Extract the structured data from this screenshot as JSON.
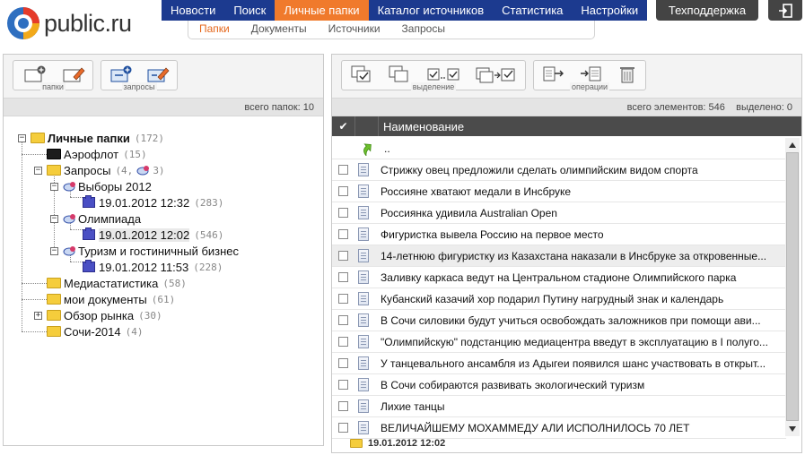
{
  "header": {
    "logo_text": "public.ru",
    "nav": [
      "Новости",
      "Поиск",
      "Личные папки",
      "Каталог источников",
      "Статистика",
      "Настройки"
    ],
    "nav_active": 2,
    "subnav": [
      "Папки",
      "Документы",
      "Источники",
      "Запросы"
    ],
    "subnav_active": 0,
    "support_label": "Техподдержка",
    "accent_color": "#f07a2c",
    "nav_color": "#1c3a8f"
  },
  "left_panel": {
    "toolbar_groups": [
      "папки",
      "запросы"
    ],
    "info": "всего папок: 10",
    "tree": [
      {
        "label": "Личные папки",
        "count": "(172)"
      },
      {
        "label": "Аэрофлот",
        "count": "(15)"
      },
      {
        "label": "Запросы",
        "count": "(4,",
        "count2": "3)"
      },
      {
        "label": "Выборы 2012",
        "count": ""
      },
      {
        "label": "19.01.2012 12:32",
        "count": "(283)"
      },
      {
        "label": "Олимпиада",
        "count": ""
      },
      {
        "label": "19.01.2012 12:02",
        "count": "(546)"
      },
      {
        "label": "Туризм и гостиничный бизнес",
        "count": ""
      },
      {
        "label": "19.01.2012 11:53",
        "count": "(228)"
      },
      {
        "label": "Медиастатистика",
        "count": "(58)"
      },
      {
        "label": "мои документы",
        "count": "(61)"
      },
      {
        "label": "Обзор рынка",
        "count": "(30)"
      },
      {
        "label": "Сочи-2014",
        "count": "(4)"
      }
    ]
  },
  "right_panel": {
    "toolbar_groups": [
      "выделение",
      "операции"
    ],
    "info": "всего элементов: 546    выделено: 0",
    "column_name": "Наименование",
    "up_label": "..",
    "rows": [
      "Стрижку овец предложили сделать олимпийским видом спорта",
      "Россияне хватают медали в Инсбруке",
      "Россиянка удивила Australian Open",
      "Фигуристка вывела Россию на первое место",
      "14-летнюю фигуристку из Казахстана наказали в Инсбруке за откровенные...",
      "Заливку каркаса ведут на Центральном стадионе Олимпийского парка",
      "Кубанский казачий хор подарил Путину нагрудный знак и календарь",
      "В Сочи силовики будут учиться освобождать заложников при помощи ави...",
      "\"Олимпийскую\" подстанцию медиацентра введут в эксплуатацию в I полуго...",
      "У танцевального ансамбля из Адыгеи появился шанс участвовать в открыт...",
      "В Сочи собираются развивать экологический туризм",
      "Лихие танцы",
      "ВЕЛИЧАЙШЕМУ МОХАММЕДУ АЛИ ИСПОЛНИЛОСЬ 70 ЛЕТ"
    ],
    "footer_path": "19.01.2012 12:02"
  }
}
